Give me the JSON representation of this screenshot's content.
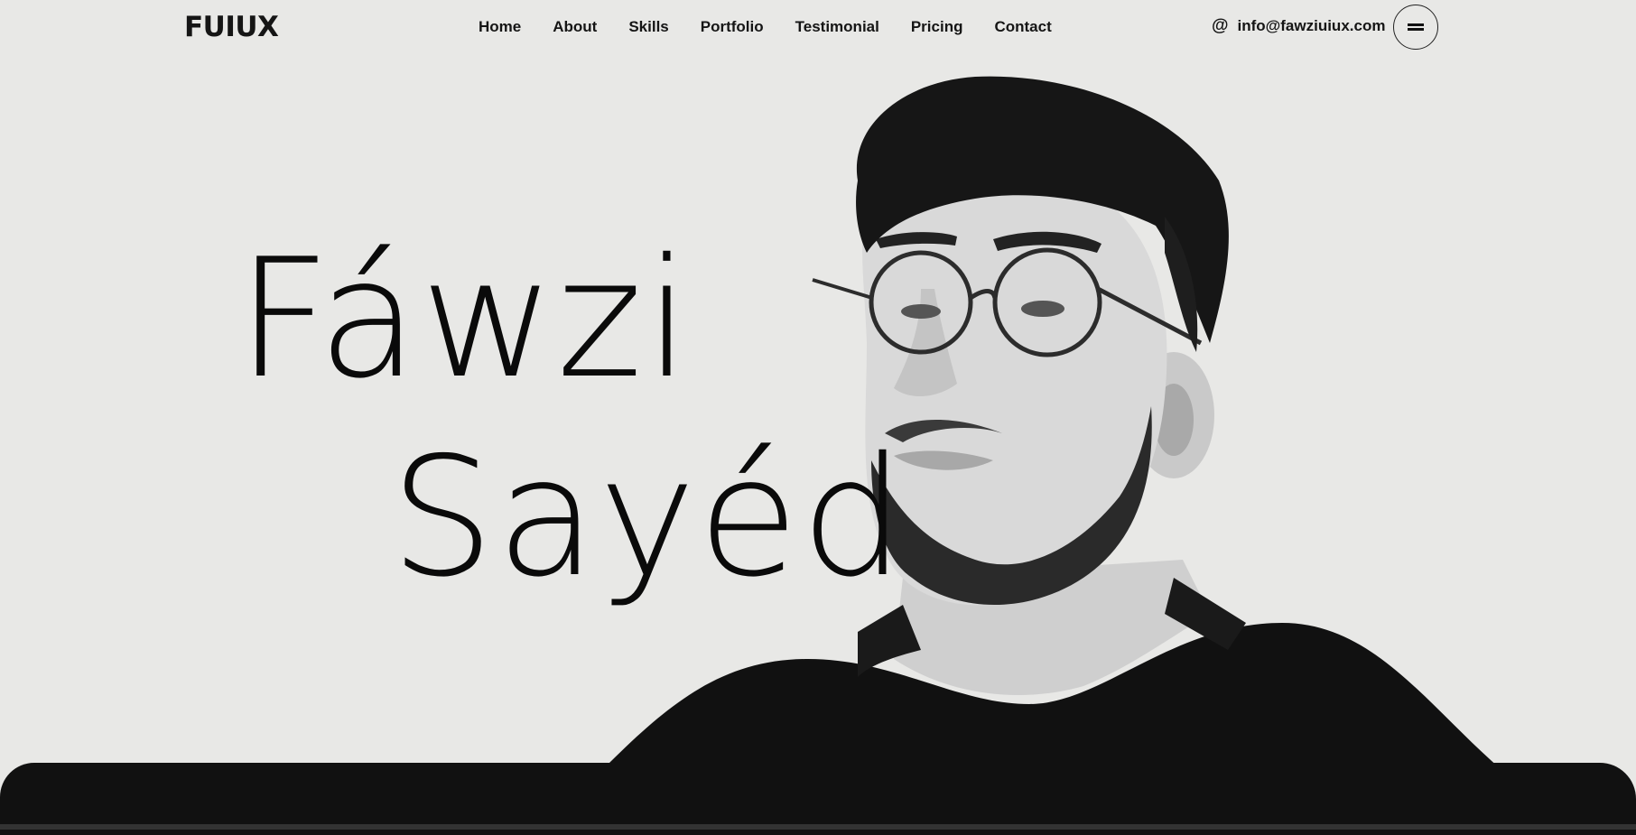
{
  "brand": {
    "logo": "FUIUX"
  },
  "nav": {
    "items": [
      "Home",
      "About",
      "Skills",
      "Portfolio",
      "Testimonial",
      "Pricing",
      "Contact"
    ]
  },
  "contact": {
    "icon": "at-icon",
    "email": "info@fawziuiux.com"
  },
  "menu": {
    "icon": "hamburger-icon"
  },
  "hero": {
    "first_name": "Fáwzi",
    "last_name": "Sayéd",
    "image": "portrait-photo"
  },
  "colors": {
    "background": "#e8e8e6",
    "text": "#111111",
    "dark": "#111111"
  }
}
